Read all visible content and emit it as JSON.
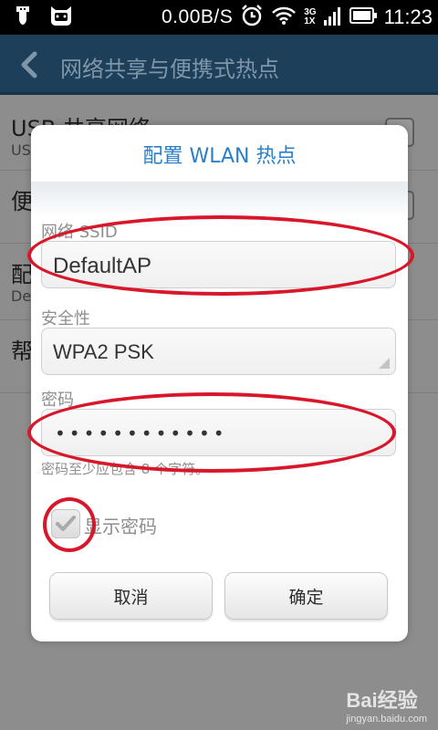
{
  "status_bar": {
    "net_speed": "0.00B/S",
    "network_top": "3G",
    "network_bottom": "1X",
    "time": "11:23",
    "icons": [
      "usb-icon",
      "cat-face-icon",
      "alarm-icon",
      "wifi-icon",
      "signal-icon",
      "battery-icon"
    ]
  },
  "action_bar": {
    "title": "网络共享与便携式热点"
  },
  "settings_list": {
    "items": [
      {
        "title": "USB 共享网络",
        "subtitle": "US"
      },
      {
        "title": "便",
        "subtitle": ""
      },
      {
        "title": "配",
        "subtitle": "De"
      },
      {
        "title": "帮",
        "subtitle": ""
      }
    ]
  },
  "dialog": {
    "title": "配置 WLAN 热点",
    "ssid_label": "网络 SSID",
    "ssid_value": "DefaultAP",
    "security_label": "安全性",
    "security_value": "WPA2 PSK",
    "password_label": "密码",
    "password_mask": "••••••••••••",
    "password_hint": "密码至少应包含 8 个字符。",
    "show_password_label": "显示密码",
    "show_password_checked": true,
    "cancel_label": "取消",
    "confirm_label": "确定"
  },
  "colors": {
    "accent": "#2a7fc8",
    "annotation": "#d8182a"
  },
  "watermark": {
    "main": "Bai经验",
    "sub": "jingyan.baidu.com"
  }
}
